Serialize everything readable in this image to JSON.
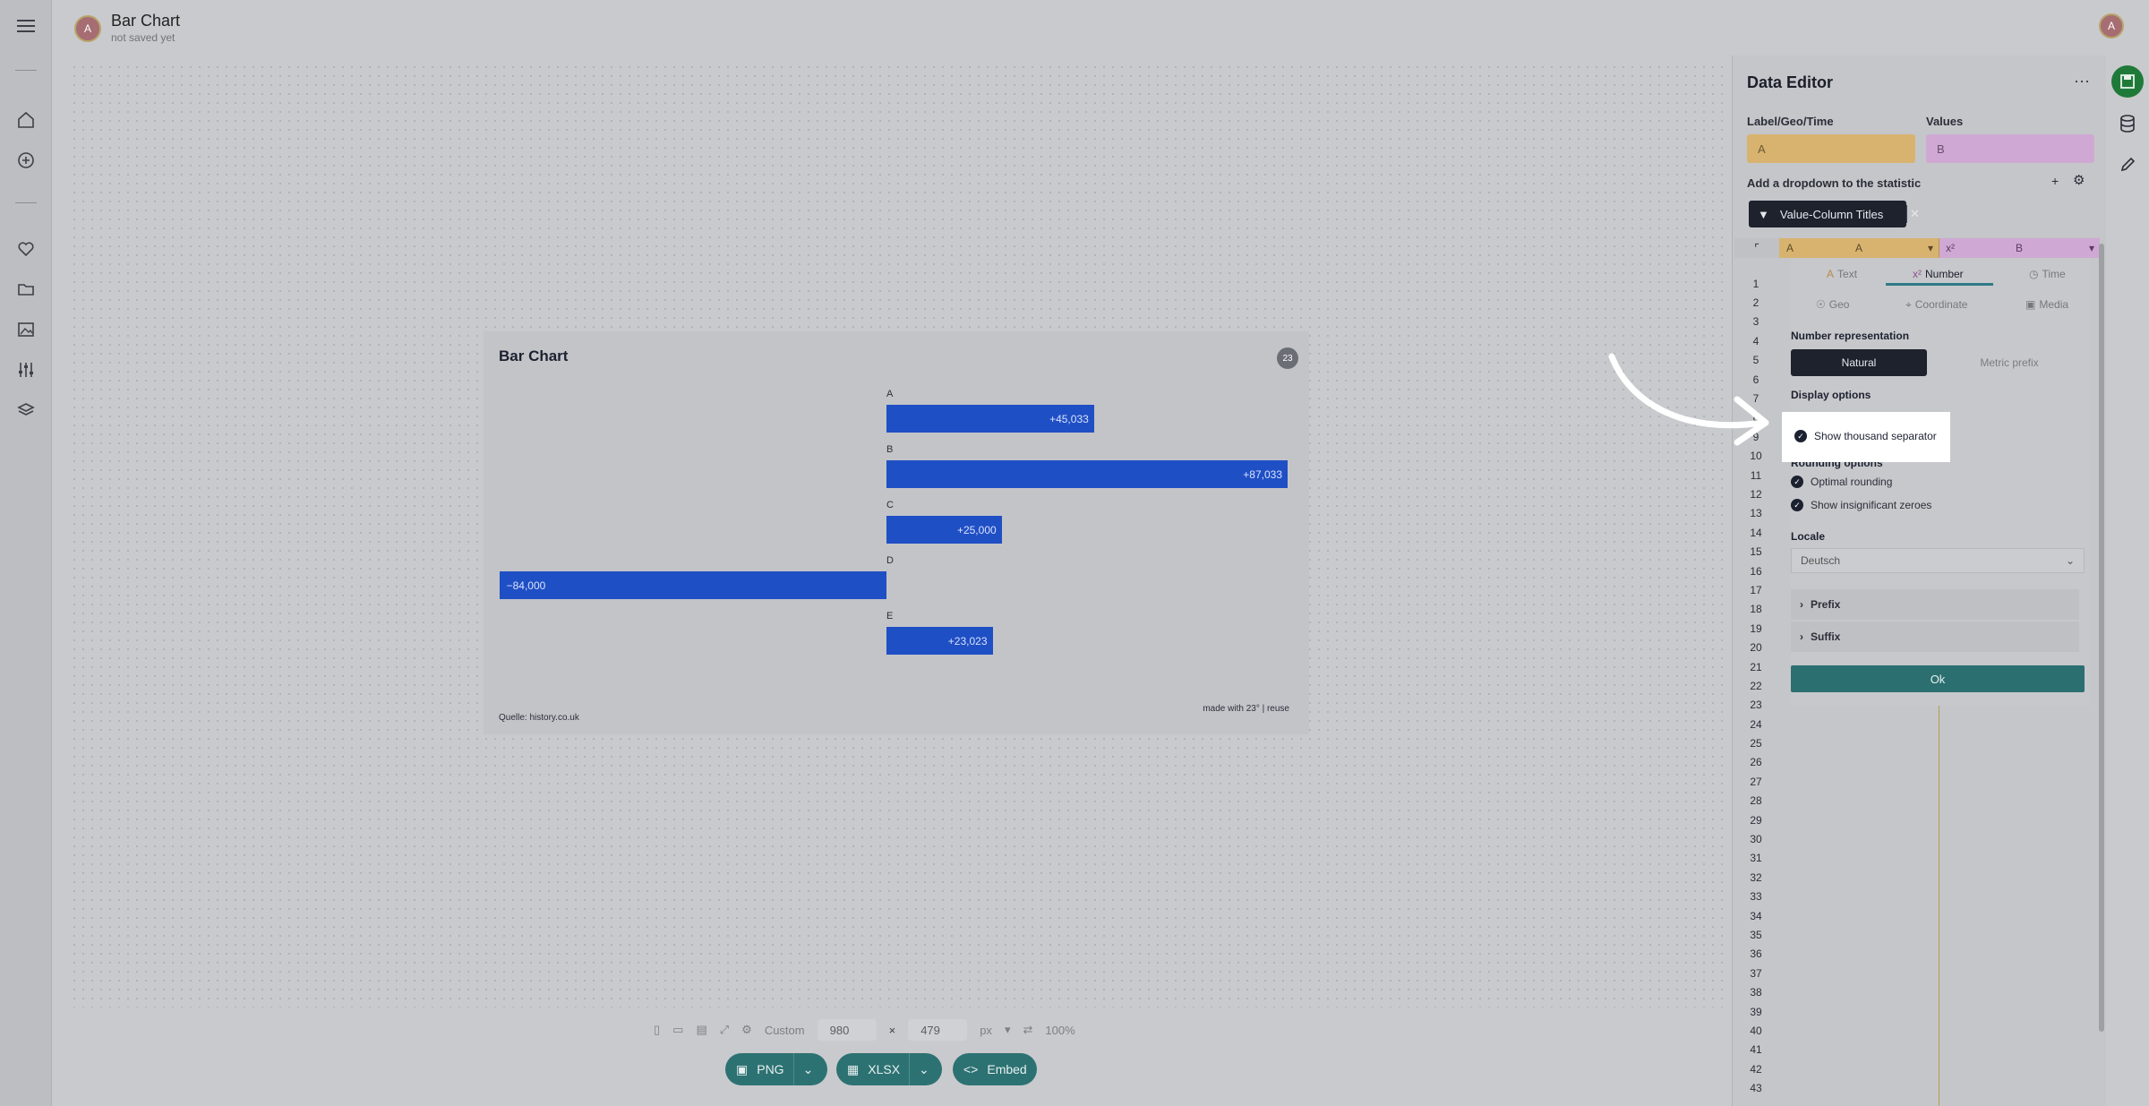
{
  "header": {
    "title": "Bar Chart",
    "subtitle": "not saved yet",
    "avatar_letter": "A",
    "user_avatar_letter": "A"
  },
  "rail": {
    "icons": [
      "menu-icon",
      "home-icon",
      "plus-circle-icon",
      "heart-icon",
      "folder-icon",
      "image-icon",
      "sliders-icon",
      "layers-icon"
    ]
  },
  "chart": {
    "title": "Bar Chart",
    "logo": "23",
    "source": "Quelle: history.co.uk",
    "made_with": "made with 23° | reuse",
    "chart_data": {
      "type": "bar",
      "orientation": "horizontal",
      "categories": [
        "A",
        "B",
        "C",
        "D",
        "E"
      ],
      "values": [
        45033,
        87033,
        25000,
        -84000,
        23023
      ],
      "value_labels": [
        "+45,033",
        "+87,033",
        "+25,000",
        "−84,000",
        "+23,023"
      ],
      "title": "Bar Chart",
      "xlabel": "",
      "ylabel": "",
      "grid": false,
      "colors": [
        "#1f4fc4"
      ]
    }
  },
  "size_controls": {
    "preset_label": "Custom",
    "width": "980",
    "height": "479",
    "unit": "px",
    "zoom": "100%",
    "times": "×"
  },
  "export": {
    "png_label": "PNG",
    "xlsx_label": "XLSX",
    "embed_label": "Embed"
  },
  "editor": {
    "title": "Data Editor",
    "more": "···",
    "label_geo_time": "Label/Geo/Time",
    "values_label": "Values",
    "label_field": "A",
    "values_field": "B",
    "dropdown_label": "Add a dropdown to the statistic",
    "chip_label": "Value-Column Titles",
    "col_a": "A",
    "col_b": "B",
    "rows": [
      "1",
      "2",
      "3",
      "4",
      "5",
      "6",
      "7",
      "8",
      "9",
      "10",
      "11",
      "12",
      "13",
      "14",
      "15",
      "16",
      "17",
      "18",
      "19",
      "20",
      "21",
      "22",
      "23",
      "24",
      "25",
      "26",
      "27",
      "28",
      "29",
      "30",
      "31",
      "32",
      "33",
      "34",
      "35",
      "36",
      "37",
      "38",
      "39",
      "40",
      "41",
      "42",
      "43"
    ]
  },
  "type_modal": {
    "tabs": {
      "text": "Text",
      "number": "Number",
      "time": "Time",
      "geo": "Geo",
      "coordinate": "Coordinate",
      "media": "Media"
    },
    "number_representation": "Number representation",
    "natural": "Natural",
    "metric_prefix": "Metric prefix",
    "display_options": "Display options",
    "show_thousand_separator": "Show thousand separator",
    "rounding_options": "Rounding options",
    "optimal_rounding": "Optimal rounding",
    "show_insignificant_zeroes": "Show insignificant zeroes",
    "locale_label": "Locale",
    "locale_value": "Deutsch",
    "prefix": "Prefix",
    "suffix": "Suffix",
    "ok": "Ok"
  },
  "colors": {
    "bar": "#1f4fc4",
    "accent": "#2d7273",
    "label_col": "#d8b370",
    "value_col": "#cfa9d4"
  }
}
